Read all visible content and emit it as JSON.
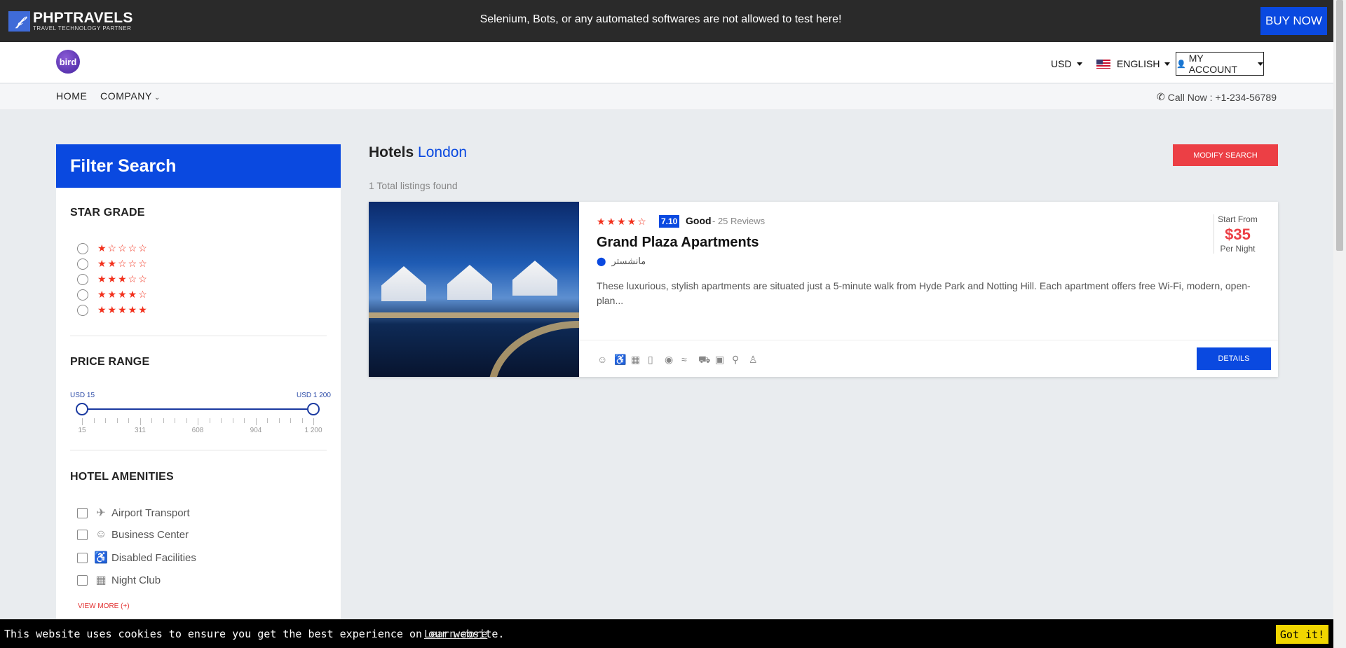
{
  "topbar": {
    "logo_mark": "𝒻",
    "logo_name": "PHPTRAVELS",
    "logo_tagline": "TRAVEL TECHNOLOGY PARTNER",
    "notice": "Selenium, Bots, or any automated softwares are not allowed to test here!",
    "buy_now": "BUY NOW"
  },
  "header": {
    "brand": "bird",
    "currency": "USD",
    "language": "ENGLISH",
    "account": "MY ACCOUNT"
  },
  "nav": {
    "home": "HOME",
    "company": "COMPANY",
    "call": "Call Now : +1-234-56789"
  },
  "filter": {
    "title": "Filter Search",
    "star_grade_title": "STAR GRADE",
    "star_options": [
      "★☆☆☆☆",
      "★★☆☆☆",
      "★★★☆☆",
      "★★★★☆",
      "★★★★★"
    ],
    "price_title": "PRICE RANGE",
    "price_min_label": "USD 15",
    "price_max_label": "USD 1 200",
    "price_ticks": [
      "15",
      "311",
      "608",
      "904",
      "1 200"
    ],
    "amenities_title": "HOTEL AMENITIES",
    "amenities": [
      "Airport Transport",
      "Business Center",
      "Disabled Facilities",
      "Night Club"
    ],
    "view_more": "VIEW MORE (+)"
  },
  "results": {
    "title_prefix": "Hotels",
    "title_city": "London",
    "modify_button": "MODIFY SEARCH",
    "count_text": "1 Total listings found"
  },
  "hotel": {
    "stars": "★★★★☆",
    "score": "7.10",
    "rating_word": "Good",
    "reviews": "- 25 Reviews",
    "name": "Grand Plaza Apartments",
    "location": "مانشستر",
    "description": "These luxurious, stylish apartments are situated just a 5-minute walk from Hyde Park and Notting Hill. Each apartment offers free Wi-Fi, modern, open-plan...",
    "start_from": "Start From",
    "price": "$35",
    "per_night": "Per Night",
    "details_button": "DETAILS"
  },
  "cookie": {
    "message": "This website uses cookies to ensure you get the best experience on our website.",
    "learn_more": "Learn more",
    "accept": "Got it!"
  },
  "colors": {
    "primary": "#0a49e0",
    "accent_red": "#ec3f45",
    "star": "#f2311d",
    "cookie_button": "#f1d600"
  }
}
